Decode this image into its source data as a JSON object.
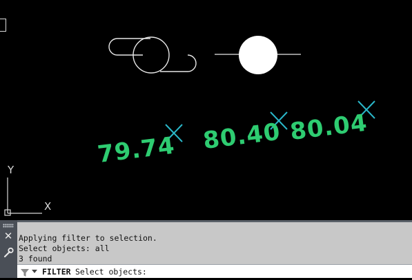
{
  "drawing": {
    "elevation_labels": [
      "79.74",
      "80.40",
      "80.04"
    ],
    "elevation_color": "#2ecc71",
    "marker_color": "#2ab7c9",
    "ucs_axis_labels": {
      "y": "Y",
      "x": "X"
    }
  },
  "command_line": {
    "history": [
      "Applying filter to selection.",
      "Select objects: all",
      "3 found"
    ],
    "command_name": "FILTER",
    "prompt": "Select objects:",
    "input_value": ""
  },
  "icons": {
    "close": "close-icon",
    "settings": "wrench-icon",
    "filter": "filter-icon",
    "grip": "grip-icon"
  }
}
